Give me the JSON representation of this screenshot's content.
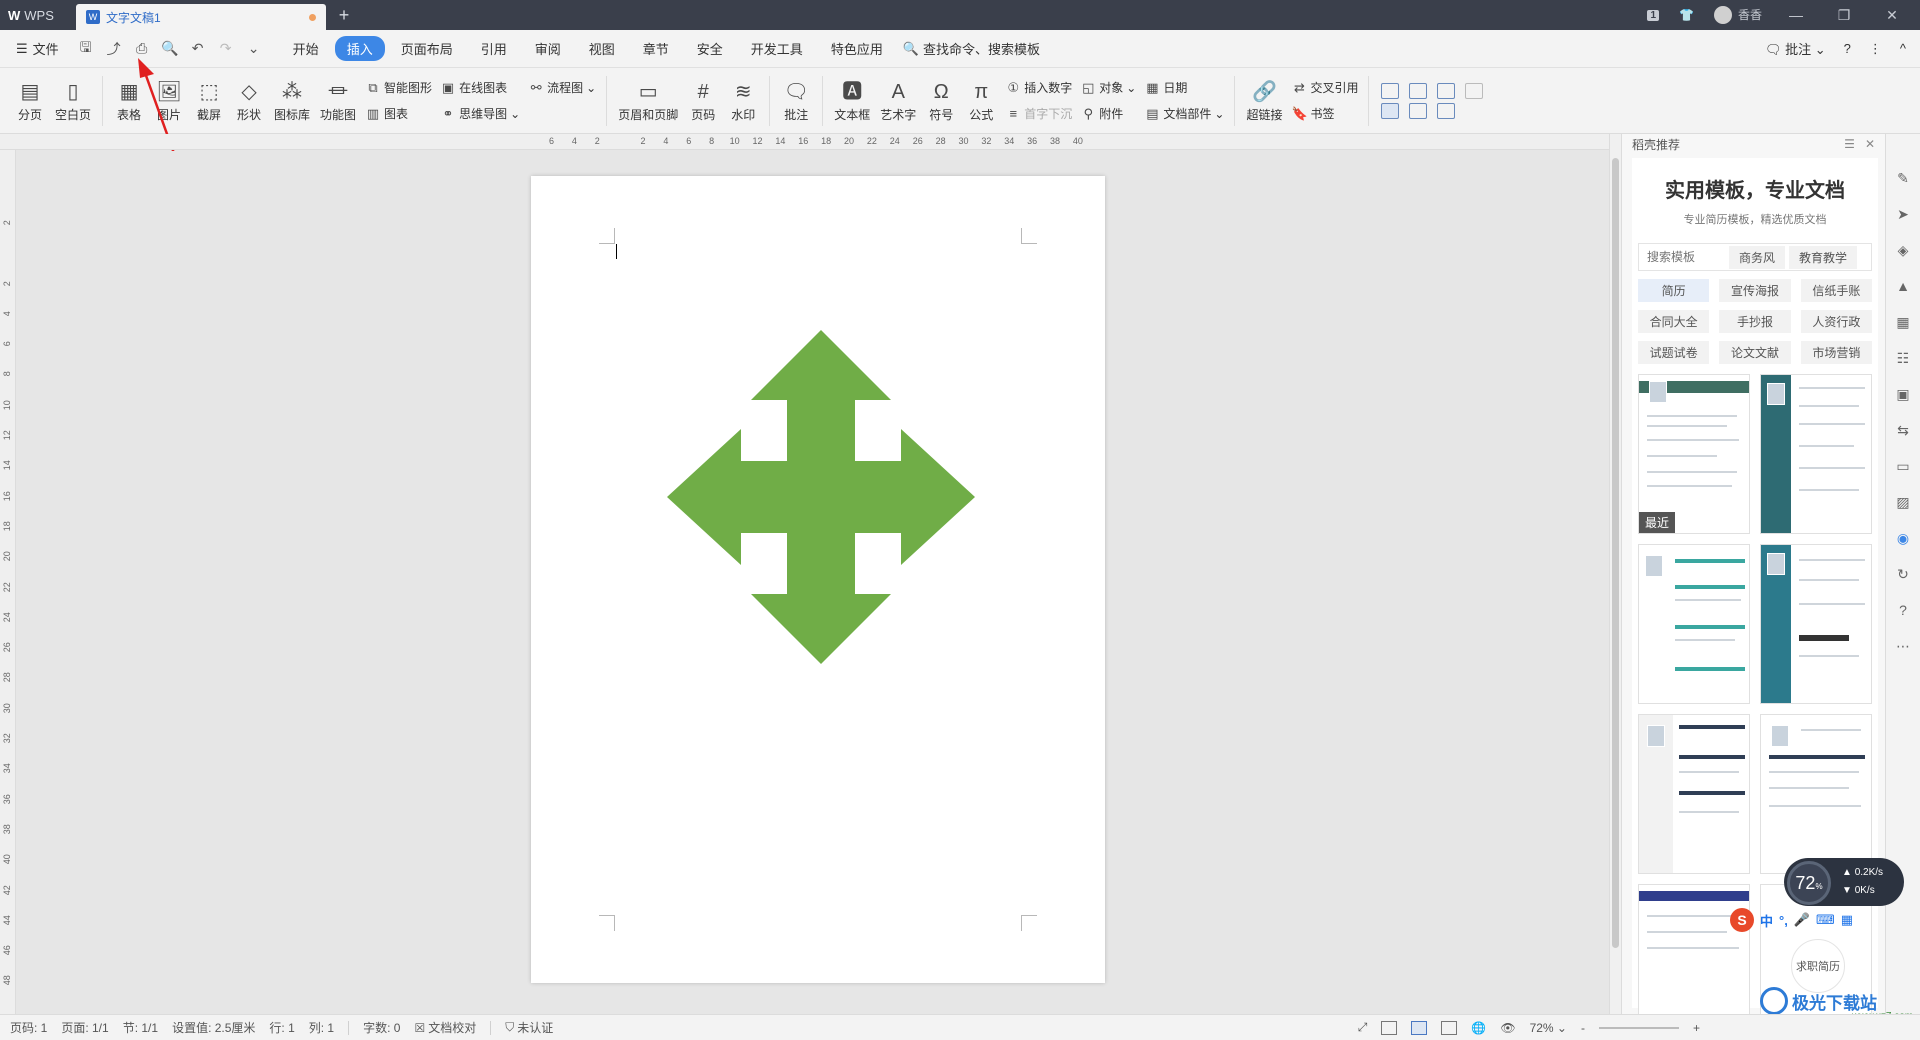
{
  "titlebar": {
    "app_label": "WPS",
    "doc_tab": "文字文稿1",
    "new_tab_symbol": "+",
    "badge": "1",
    "user_name": "香香"
  },
  "menubar": {
    "file_label": "文件",
    "tabs": [
      {
        "label": "开始"
      },
      {
        "label": "插入",
        "active": true
      },
      {
        "label": "页面布局"
      },
      {
        "label": "引用"
      },
      {
        "label": "审阅"
      },
      {
        "label": "视图"
      },
      {
        "label": "章节"
      },
      {
        "label": "安全"
      },
      {
        "label": "开发工具"
      },
      {
        "label": "特色应用"
      }
    ],
    "search_label": "查找命令、搜索模板",
    "comment_label": "批注",
    "help_symbol": "?",
    "more_symbol": "⋮",
    "collapse_symbol": "^"
  },
  "ribbon": {
    "page_break": "分页",
    "blank_page": "空白页",
    "table": "表格",
    "picture": "图片",
    "screenshot": "截屏",
    "shapes": "形状",
    "icon_lib": "图标库",
    "func_chart": "功能图",
    "smart_art": "智能图形",
    "online_chart": "在线图表",
    "flowchart": "流程图",
    "chart": "图表",
    "mindmap": "思维导图",
    "header_footer": "页眉和页脚",
    "page_number": "页码",
    "watermark": "水印",
    "comment": "批注",
    "textbox": "文本框",
    "wordart": "艺术字",
    "symbol": "符号",
    "formula": "公式",
    "insert_number": "插入数字",
    "object": "对象",
    "date": "日期",
    "dropcap": "首字下沉",
    "attachment": "附件",
    "doc_parts": "文档部件",
    "hyperlink": "超链接",
    "cross_ref": "交叉引用",
    "bookmark": "书签"
  },
  "ruler": {
    "h_ticks": [
      "6",
      "4",
      "2",
      "",
      "2",
      "4",
      "6",
      "8",
      "10",
      "12",
      "14",
      "16",
      "18",
      "20",
      "22",
      "24",
      "26",
      "28",
      "30",
      "32",
      "34",
      "36",
      "38",
      "40"
    ],
    "v_ticks": [
      "2",
      "",
      "2",
      "4",
      "6",
      "8",
      "10",
      "12",
      "14",
      "16",
      "18",
      "20",
      "22",
      "24",
      "26",
      "28",
      "30",
      "32",
      "34",
      "36",
      "38",
      "40",
      "42",
      "44",
      "46",
      "48"
    ]
  },
  "document": {
    "shape": "four-way-arrow",
    "shape_color": "#70ad47"
  },
  "panel": {
    "header": "稻壳推荐",
    "title": "实用模板，专业文档",
    "subtitle": "专业简历模板，精选优质文档",
    "search_placeholder": "搜索模板",
    "chips": [
      "商务风",
      "教育教学"
    ],
    "categories": [
      "简历",
      "宣传海报",
      "信纸手账",
      "合同大全",
      "手抄报",
      "人资行政",
      "试题试卷",
      "论文文献",
      "市场营销"
    ],
    "recent_badge": "最近",
    "template_label": "求职简历"
  },
  "speed_widget": {
    "percent": "72",
    "percent_unit": "%",
    "up": "0.2",
    "down": "0",
    "unit": "K/s"
  },
  "ime": {
    "s": "S",
    "mode": "中"
  },
  "watermark": {
    "text": "极光下载站",
    "url": "www.xz7.com"
  },
  "statusbar": {
    "page_code": "页码: 1",
    "page": "页面: 1/1",
    "section": "节: 1/1",
    "setting": "设置值: 2.5厘米",
    "row": "行: 1",
    "col": "列: 1",
    "word_count": "字数: 0",
    "proof": "文档校对",
    "cert": "未认证",
    "zoom": "72%",
    "zoom_minus": "-",
    "zoom_plus": "+"
  },
  "colors": {
    "accent": "#3d87e6",
    "titlebar": "#3a3f4b",
    "arrow_annotation": "#e02020"
  }
}
